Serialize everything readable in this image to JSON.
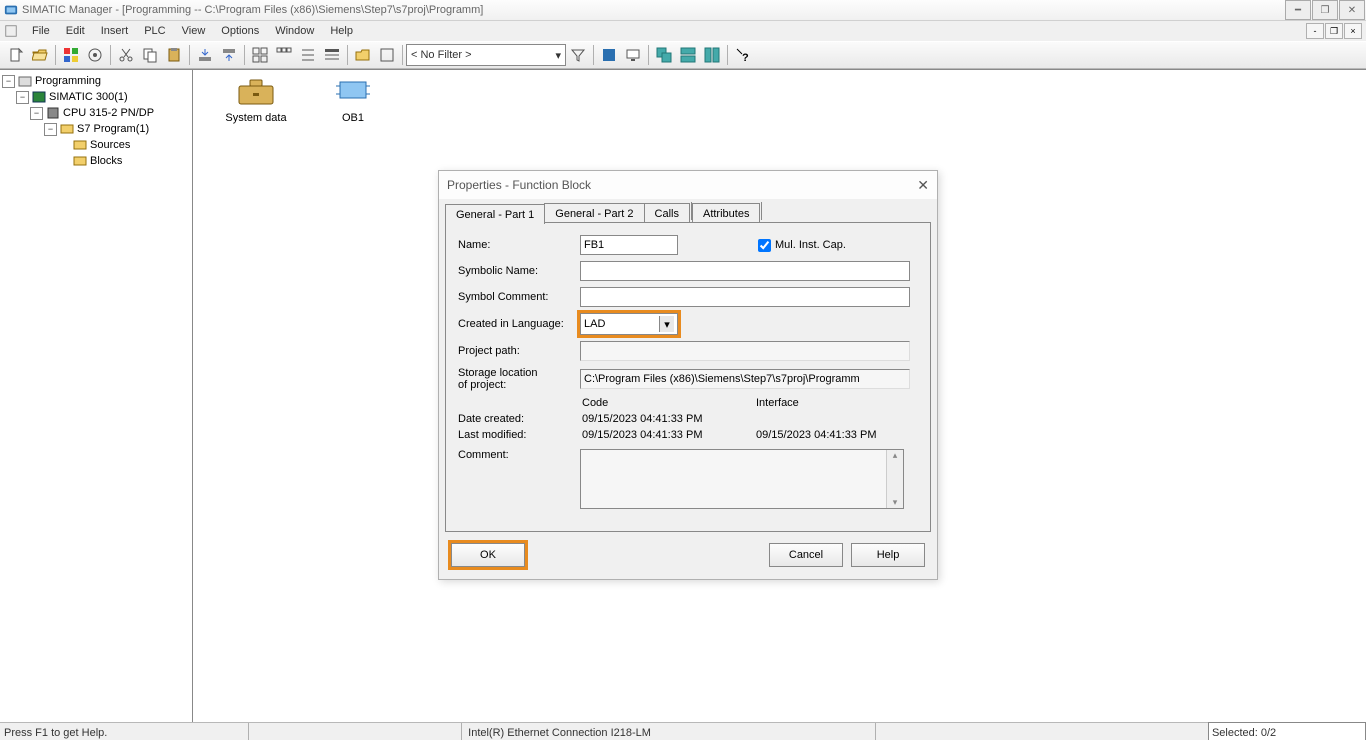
{
  "title": "SIMATIC Manager - [Programming -- C:\\Program Files (x86)\\Siemens\\Step7\\s7proj\\Programm]",
  "menu": [
    "File",
    "Edit",
    "Insert",
    "PLC",
    "View",
    "Options",
    "Window",
    "Help"
  ],
  "filter": "< No Filter >",
  "tree": {
    "root": "Programming",
    "n1": "SIMATIC 300(1)",
    "n2": "CPU 315-2 PN/DP",
    "n3": "S7 Program(1)",
    "n4a": "Sources",
    "n4b": "Blocks"
  },
  "content": {
    "i1": "System data",
    "i2": "OB1"
  },
  "status": {
    "hint": "Press F1 to get Help.",
    "nic": "Intel(R) Ethernet Connection I218-LM",
    "sel": "Selected: 0/2"
  },
  "dialog": {
    "title": "Properties - Function Block",
    "tabs": [
      "General - Part 1",
      "General - Part 2",
      "Calls",
      "Attributes"
    ],
    "labels": {
      "name": "Name:",
      "sym": "Symbolic Name:",
      "symc": "Symbol Comment:",
      "lang": "Created in Language:",
      "pp": "Project path:",
      "stor1": "Storage location",
      "stor2": "of project:",
      "code": "Code",
      "iface": "Interface",
      "dc": "Date created:",
      "lm": "Last modified:",
      "cm": "Comment:",
      "mic": "Mul. Inst. Cap."
    },
    "values": {
      "name": "FB1",
      "sym": "",
      "symc": "",
      "lang": "LAD",
      "pp": "",
      "stor": "C:\\Program Files (x86)\\Siemens\\Step7\\s7proj\\Programm",
      "code_dc": "09/15/2023 04:41:33 PM",
      "code_lm": "09/15/2023 04:41:33 PM",
      "iface_lm": "09/15/2023 04:41:33 PM"
    },
    "buttons": {
      "ok": "OK",
      "cancel": "Cancel",
      "help": "Help"
    }
  }
}
